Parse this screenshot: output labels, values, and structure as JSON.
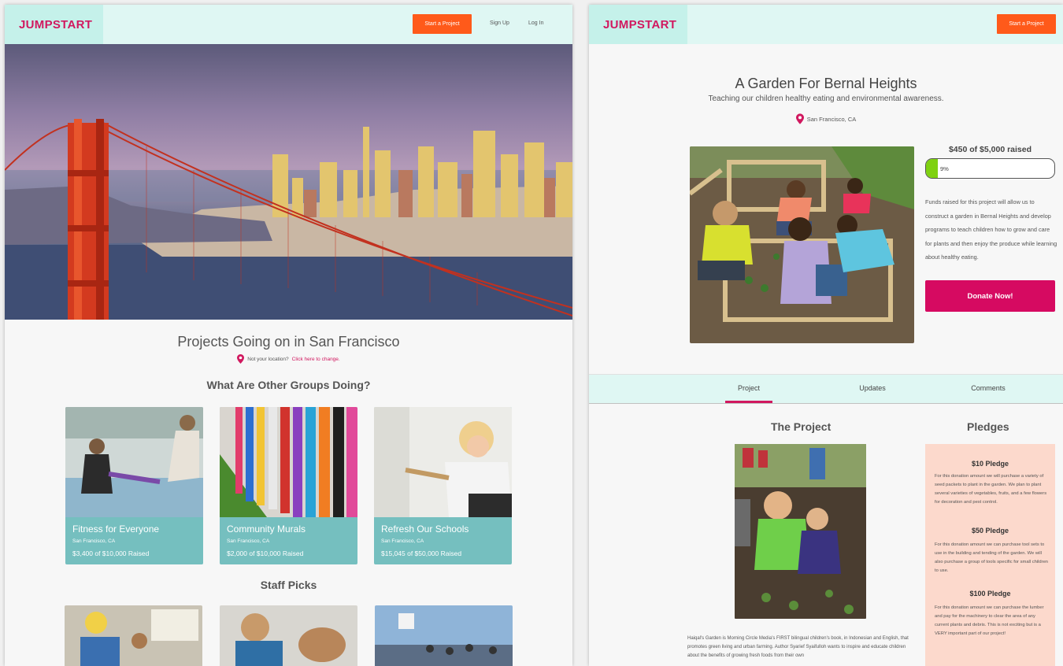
{
  "left_page": {
    "nav": {
      "logo": "JUMPSTART",
      "start_project": "Start a Project",
      "sign_up": "Sign Up",
      "log_in": "Log In"
    },
    "location_heading": "Projects Going on in San Francisco",
    "location_prompt": "Not your location?",
    "location_change_link": "Click here to change.",
    "groups_heading": "What Are Other Groups Doing?",
    "cards": [
      {
        "title": "Fitness for Everyone",
        "location": "San Francisco, CA",
        "raised": "$3,400 of $10,000 Raised"
      },
      {
        "title": "Community Murals",
        "location": "San Francisco, CA",
        "raised": "$2,000 of $10,000 Raised"
      },
      {
        "title": "Refresh Our Schools",
        "location": "San Francisco, CA",
        "raised": "$15,045 of $50,000 Raised"
      }
    ],
    "staff_picks_heading": "Staff Picks"
  },
  "right_page": {
    "nav": {
      "logo": "JUMPSTART",
      "start_project": "Start a Project"
    },
    "project_title": "A Garden For Bernal Heights",
    "project_subtitle": "Teaching our children healthy eating and environmental awareness.",
    "project_location": "San Francisco, CA",
    "raised_text": "$450 of $5,000 raised",
    "progress_percent_label": "9%",
    "progress_fraction": 0.09,
    "description": "Funds raised for this project will allow us to construct a garden in Bernal Heights and develop programs to teach children how to grow and care for plants and then enjoy the produce while learning about healthy eating.",
    "donate_label": "Donate Now!",
    "tabs": [
      "Project",
      "Updates",
      "Comments"
    ],
    "the_project_heading": "The Project",
    "pledges_heading": "Pledges",
    "project_text": "Haiqal's Garden is Morning Circle Media's FIRST bilingual children's book, in Indonesian and English, that promotes green living and urban farming. Author Syarief Syaifulloh wants to inspire and educate children about the benefits of growing fresh foods from their own",
    "pledges": [
      {
        "title": "$10 Pledge",
        "text": "For this donation amount we will purchase a variety of seed packets to plant in the garden. We plan to plant several varieties of vegetables, fruits, and a few flowers for decoration and pest control."
      },
      {
        "title": "$50 Pledge",
        "text": "For this donation amount we can purchase tool sets to use in the building and tending of the garden. We will also purchase a group of tools specific for small children to use."
      },
      {
        "title": "$100 Pledge",
        "text": "For this donation amount we can purchase the lumber and pay for the machinery to clear the area of any current plants and debris. This is not exciting but is a VERY important part of our project!"
      }
    ]
  },
  "colors": {
    "brand": "#d1185f",
    "cta_orange": "#ff5a1a",
    "nav_bg": "#dff7f3",
    "card_teal": "#75bfbf",
    "progress_green": "#7fd111",
    "pledge_bg": "#fcd9cc"
  }
}
